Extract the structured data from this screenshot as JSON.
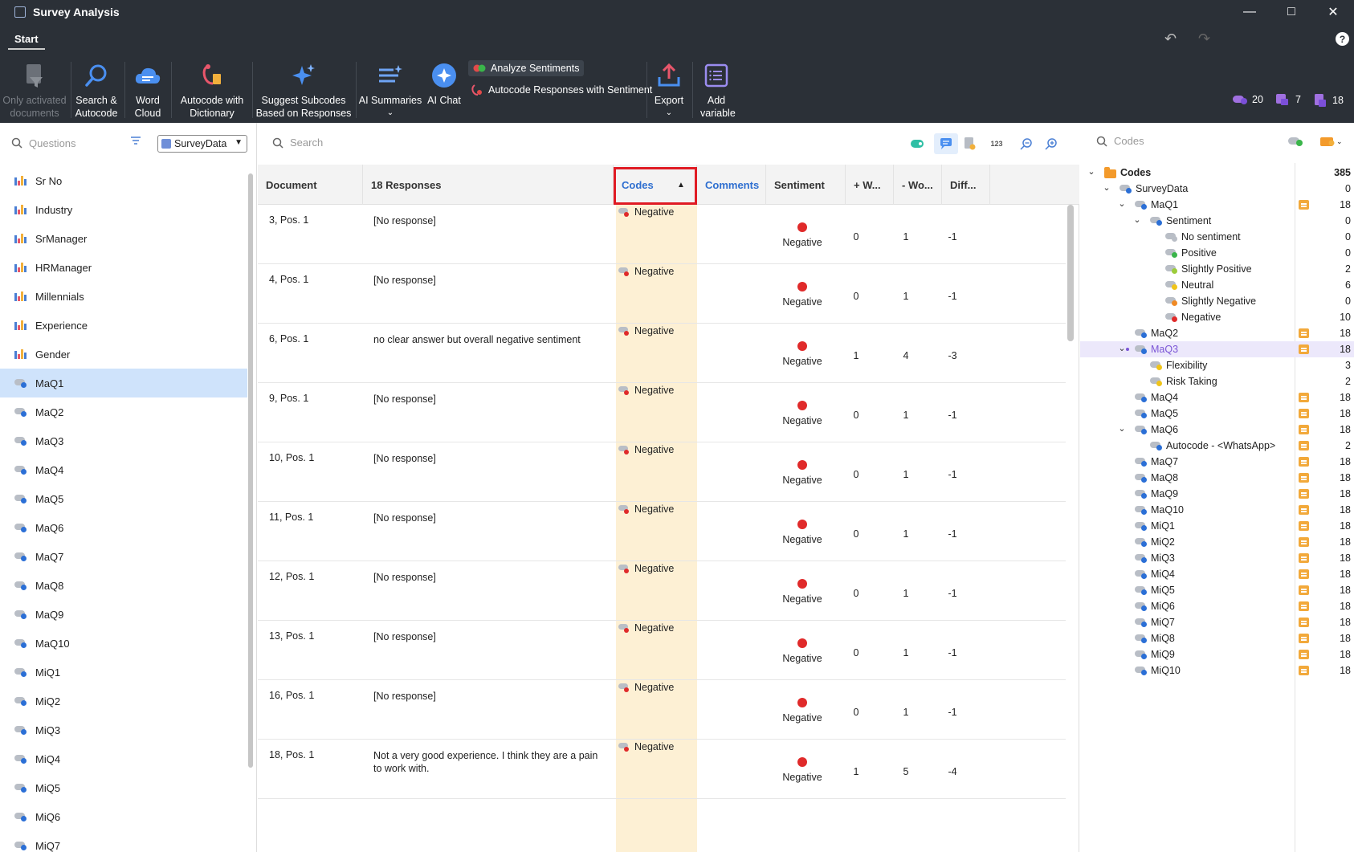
{
  "window": {
    "title": "Survey Analysis"
  },
  "tabs": {
    "start": "Start"
  },
  "ribbon": {
    "only_activated": "Only activated documents",
    "search_autocode": "Search & Autocode",
    "word_cloud": "Word Cloud",
    "autocode_dictionary": "Autocode with Dictionary",
    "suggest_subcodes": "Suggest Subcodes Based on Responses",
    "ai_summaries": "AI Summaries",
    "ai_chat": "AI Chat",
    "analyze_sentiments": "Analyze Sentiments",
    "autocode_sentiment": "Autocode Responses with Sentiment",
    "export": "Export",
    "add_variable": "Add variable",
    "count_codes": "20",
    "count_memos": "7",
    "count_docs": "18"
  },
  "left": {
    "search_placeholder": "Questions",
    "select_value": "SurveyData",
    "items": [
      {
        "label": "Sr No",
        "type": "var"
      },
      {
        "label": "Industry",
        "type": "var"
      },
      {
        "label": "SrManager",
        "type": "var"
      },
      {
        "label": "HRManager",
        "type": "var"
      },
      {
        "label": "Millennials",
        "type": "var"
      },
      {
        "label": "Experience",
        "type": "var"
      },
      {
        "label": "Gender",
        "type": "var"
      },
      {
        "label": "MaQ1",
        "type": "code",
        "selected": true
      },
      {
        "label": "MaQ2",
        "type": "code"
      },
      {
        "label": "MaQ3",
        "type": "code"
      },
      {
        "label": "MaQ4",
        "type": "code"
      },
      {
        "label": "MaQ5",
        "type": "code"
      },
      {
        "label": "MaQ6",
        "type": "code"
      },
      {
        "label": "MaQ7",
        "type": "code"
      },
      {
        "label": "MaQ8",
        "type": "code"
      },
      {
        "label": "MaQ9",
        "type": "code"
      },
      {
        "label": "MaQ10",
        "type": "code"
      },
      {
        "label": "MiQ1",
        "type": "code"
      },
      {
        "label": "MiQ2",
        "type": "code"
      },
      {
        "label": "MiQ3",
        "type": "code"
      },
      {
        "label": "MiQ4",
        "type": "code"
      },
      {
        "label": "MiQ5",
        "type": "code"
      },
      {
        "label": "MiQ6",
        "type": "code"
      },
      {
        "label": "MiQ7",
        "type": "code"
      }
    ]
  },
  "center": {
    "search_placeholder": "Search",
    "tool_123": "123",
    "headers": {
      "document": "Document",
      "responses": "18 Responses",
      "codes": "Codes",
      "comments": "Comments",
      "sentiment": "Sentiment",
      "plus_words": "+ W...",
      "minus_words": "- Wo...",
      "diff": "Diff..."
    },
    "rows": [
      {
        "doc": "3, Pos. 1",
        "response": "[No response]",
        "code": "Negative",
        "sentiment": "Negative",
        "plus": "0",
        "minus": "1",
        "diff": "-1"
      },
      {
        "doc": "4, Pos. 1",
        "response": "[No response]",
        "code": "Negative",
        "sentiment": "Negative",
        "plus": "0",
        "minus": "1",
        "diff": "-1"
      },
      {
        "doc": "6, Pos. 1",
        "response": "no clear answer but overall negative sentiment",
        "code": "Negative",
        "sentiment": "Negative",
        "plus": "1",
        "minus": "4",
        "diff": "-3"
      },
      {
        "doc": "9, Pos. 1",
        "response": "[No response]",
        "code": "Negative",
        "sentiment": "Negative",
        "plus": "0",
        "minus": "1",
        "diff": "-1"
      },
      {
        "doc": "10, Pos. 1",
        "response": "[No response]",
        "code": "Negative",
        "sentiment": "Negative",
        "plus": "0",
        "minus": "1",
        "diff": "-1"
      },
      {
        "doc": "11, Pos. 1",
        "response": "[No response]",
        "code": "Negative",
        "sentiment": "Negative",
        "plus": "0",
        "minus": "1",
        "diff": "-1"
      },
      {
        "doc": "12, Pos. 1",
        "response": "[No response]",
        "code": "Negative",
        "sentiment": "Negative",
        "plus": "0",
        "minus": "1",
        "diff": "-1"
      },
      {
        "doc": "13, Pos. 1",
        "response": "[No response]",
        "code": "Negative",
        "sentiment": "Negative",
        "plus": "0",
        "minus": "1",
        "diff": "-1"
      },
      {
        "doc": "16, Pos. 1",
        "response": "[No response]",
        "code": "Negative",
        "sentiment": "Negative",
        "plus": "0",
        "minus": "1",
        "diff": "-1"
      },
      {
        "doc": "18, Pos. 1",
        "response": "Not a very good experience. I think they are a pain to work with.",
        "code": "Negative",
        "sentiment": "Negative",
        "plus": "1",
        "minus": "5",
        "diff": "-4"
      }
    ]
  },
  "right": {
    "search_placeholder": "Codes",
    "tree": [
      {
        "label": "Codes",
        "count": "385",
        "level": 0,
        "chev": true,
        "kind": "folder",
        "bold": true
      },
      {
        "label": "SurveyData",
        "count": "0",
        "level": 1,
        "chev": true,
        "kind": "code",
        "dot": "#2b6fd6"
      },
      {
        "label": "MaQ1",
        "count": "18",
        "level": 2,
        "chev": true,
        "kind": "code",
        "dot": "#2b6fd6",
        "memo": true
      },
      {
        "label": "Sentiment",
        "count": "0",
        "level": 3,
        "chev": true,
        "kind": "code",
        "dot": "#2b6fd6"
      },
      {
        "label": "No sentiment",
        "count": "0",
        "level": 4,
        "kind": "code",
        "dot": "#b9bec6"
      },
      {
        "label": "Positive",
        "count": "0",
        "level": 4,
        "kind": "code",
        "dot": "#3ab54a"
      },
      {
        "label": "Slightly Positive",
        "count": "2",
        "level": 4,
        "kind": "code",
        "dot": "#9ccc3a"
      },
      {
        "label": "Neutral",
        "count": "6",
        "level": 4,
        "kind": "code",
        "dot": "#f0c419"
      },
      {
        "label": "Slightly Negative",
        "count": "0",
        "level": 4,
        "kind": "code",
        "dot": "#f08a24"
      },
      {
        "label": "Negative",
        "count": "10",
        "level": 4,
        "kind": "code",
        "dot": "#e02a2a"
      },
      {
        "label": "MaQ2",
        "count": "18",
        "level": 2,
        "kind": "code",
        "dot": "#2b6fd6",
        "memo": true
      },
      {
        "label": "MaQ3",
        "count": "18",
        "level": 2,
        "chev": true,
        "kind": "code",
        "dot": "#2b6fd6",
        "memo": true,
        "selected": true
      },
      {
        "label": "Flexibility",
        "count": "3",
        "level": 3,
        "kind": "code",
        "dot": "#f0c419"
      },
      {
        "label": "Risk Taking",
        "count": "2",
        "level": 3,
        "kind": "code",
        "dot": "#f0c419"
      },
      {
        "label": "MaQ4",
        "count": "18",
        "level": 2,
        "kind": "code",
        "dot": "#2b6fd6",
        "memo": true
      },
      {
        "label": "MaQ5",
        "count": "18",
        "level": 2,
        "kind": "code",
        "dot": "#2b6fd6",
        "memo": true
      },
      {
        "label": "MaQ6",
        "count": "18",
        "level": 2,
        "chev": true,
        "kind": "code",
        "dot": "#2b6fd6",
        "memo": true
      },
      {
        "label": "Autocode - <WhatsApp>",
        "count": "2",
        "level": 3,
        "kind": "code",
        "dot": "#2b6fd6",
        "memo": true
      },
      {
        "label": "MaQ7",
        "count": "18",
        "level": 2,
        "kind": "code",
        "dot": "#2b6fd6",
        "memo": true
      },
      {
        "label": "MaQ8",
        "count": "18",
        "level": 2,
        "kind": "code",
        "dot": "#2b6fd6",
        "memo": true
      },
      {
        "label": "MaQ9",
        "count": "18",
        "level": 2,
        "kind": "code",
        "dot": "#2b6fd6",
        "memo": true
      },
      {
        "label": "MaQ10",
        "count": "18",
        "level": 2,
        "kind": "code",
        "dot": "#2b6fd6",
        "memo": true
      },
      {
        "label": "MiQ1",
        "count": "18",
        "level": 2,
        "kind": "code",
        "dot": "#2b6fd6",
        "memo": true
      },
      {
        "label": "MiQ2",
        "count": "18",
        "level": 2,
        "kind": "code",
        "dot": "#2b6fd6",
        "memo": true
      },
      {
        "label": "MiQ3",
        "count": "18",
        "level": 2,
        "kind": "code",
        "dot": "#2b6fd6",
        "memo": true
      },
      {
        "label": "MiQ4",
        "count": "18",
        "level": 2,
        "kind": "code",
        "dot": "#2b6fd6",
        "memo": true
      },
      {
        "label": "MiQ5",
        "count": "18",
        "level": 2,
        "kind": "code",
        "dot": "#2b6fd6",
        "memo": true
      },
      {
        "label": "MiQ6",
        "count": "18",
        "level": 2,
        "kind": "code",
        "dot": "#2b6fd6",
        "memo": true
      },
      {
        "label": "MiQ7",
        "count": "18",
        "level": 2,
        "kind": "code",
        "dot": "#2b6fd6",
        "memo": true
      },
      {
        "label": "MiQ8",
        "count": "18",
        "level": 2,
        "kind": "code",
        "dot": "#2b6fd6",
        "memo": true
      },
      {
        "label": "MiQ9",
        "count": "18",
        "level": 2,
        "kind": "code",
        "dot": "#2b6fd6",
        "memo": true
      },
      {
        "label": "MiQ10",
        "count": "18",
        "level": 2,
        "kind": "code",
        "dot": "#2b6fd6",
        "memo": true
      }
    ]
  }
}
